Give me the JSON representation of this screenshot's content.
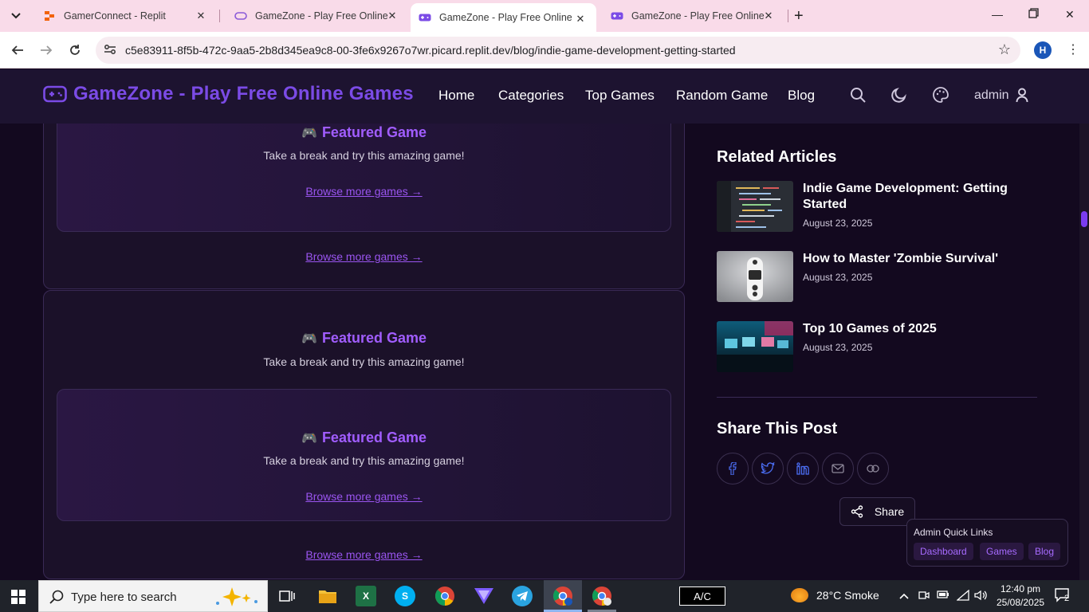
{
  "browser": {
    "tabs": [
      {
        "title": "GamerConnect - Replit",
        "active": false
      },
      {
        "title": "GameZone - Play Free Online G",
        "active": false
      },
      {
        "title": "GameZone - Play Free Online G",
        "active": true
      },
      {
        "title": "GameZone - Play Free Online G",
        "active": false
      }
    ],
    "url": "c5e83911-8f5b-472c-9aa5-2b8d345ea9c8-00-3fe6x9267o7wr.picard.replit.dev/blog/indie-game-development-getting-started",
    "profile_initial": "H"
  },
  "header": {
    "logo_text": "GameZone - Play Free Online Games",
    "nav": [
      "Home",
      "Categories",
      "Top Games",
      "Random Game",
      "Blog"
    ],
    "user": "admin"
  },
  "main": {
    "featured_title": "Featured Game",
    "featured_emoji": "🎮",
    "featured_subtitle": "Take a break and try this amazing game!",
    "browse_link": "Browse more games →"
  },
  "sidebar": {
    "related_title": "Related Articles",
    "related": [
      {
        "title": "Indie Game Development: Getting Started",
        "date": "August 23, 2025"
      },
      {
        "title": "How to Master 'Zombie Survival'",
        "date": "August 23, 2025"
      },
      {
        "title": "Top 10 Games of 2025",
        "date": "August 23, 2025"
      }
    ],
    "share_title": "Share This Post",
    "share_icons": [
      "facebook-icon",
      "twitter-icon",
      "linkedin-icon",
      "mail-icon",
      "link-icon"
    ],
    "share_button": "Share"
  },
  "quick_links": {
    "title": "Admin Quick Links",
    "links": [
      "Dashboard",
      "Games",
      "Blog"
    ]
  },
  "taskbar": {
    "search_placeholder": "Type here to search",
    "ac_label": "A/C",
    "weather": "28°C  Smoke",
    "time": "12:40 pm",
    "date": "25/08/2025",
    "notifications": "2"
  },
  "colors": {
    "accent": "#7b4be6",
    "link": "#9a55f0",
    "background": "#13091f"
  }
}
